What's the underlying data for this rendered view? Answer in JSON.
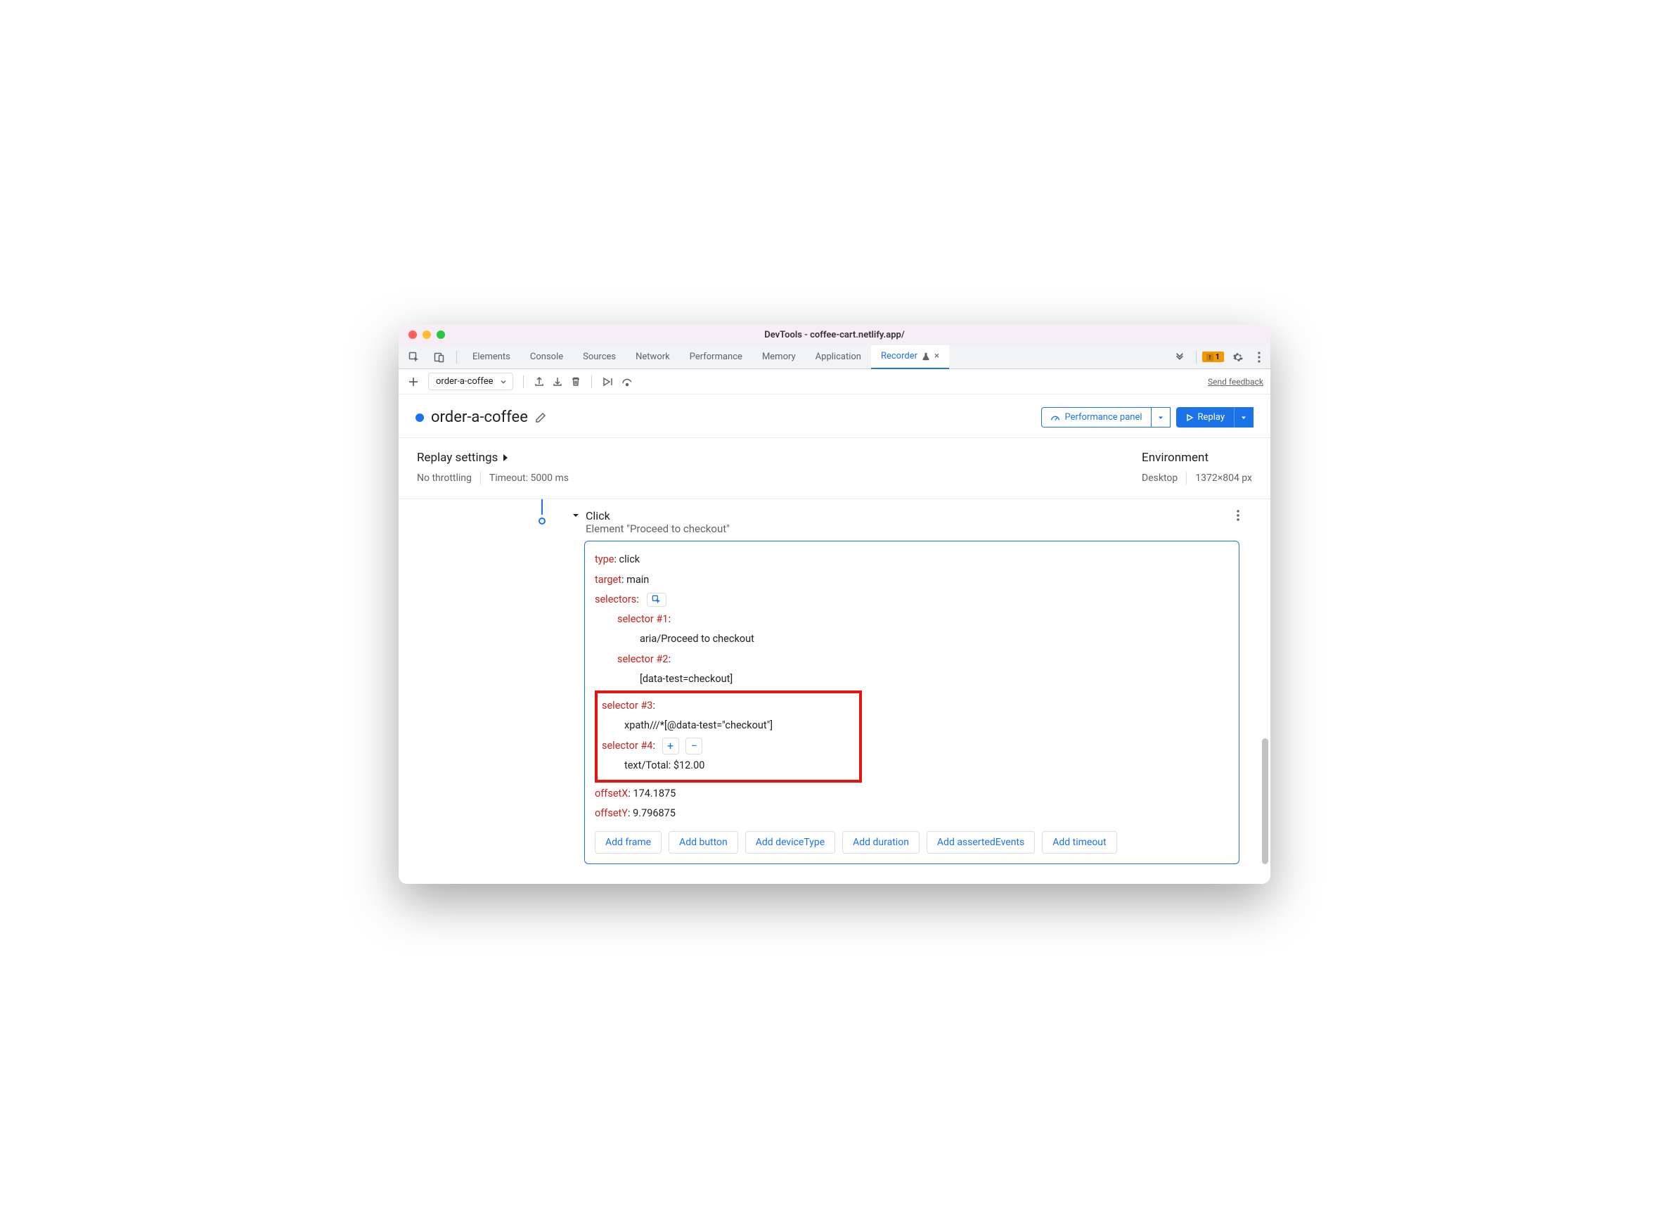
{
  "window": {
    "title": "DevTools - coffee-cart.netlify.app/"
  },
  "tabs": {
    "items": [
      "Elements",
      "Console",
      "Sources",
      "Network",
      "Performance",
      "Memory",
      "Application",
      "Recorder"
    ],
    "activeIndex": 7,
    "warning_count": "1"
  },
  "subtoolbar": {
    "recording_name": "order-a-coffee",
    "send_feedback": "Send feedback"
  },
  "header": {
    "title": "order-a-coffee",
    "perf_panel": "Performance panel",
    "replay": "Replay"
  },
  "settings": {
    "replay_heading": "Replay settings",
    "throttling": "No throttling",
    "timeout": "Timeout: 5000 ms",
    "env_heading": "Environment",
    "device": "Desktop",
    "dimensions": "1372×804 px"
  },
  "step": {
    "title": "Click",
    "subtitle": "Element \"Proceed to checkout\"",
    "type_key": "type",
    "type_val": "click",
    "target_key": "target",
    "target_val": "main",
    "selectors_key": "selectors",
    "sel1_key": "selector #1",
    "sel1_val": "aria/Proceed to checkout",
    "sel2_key": "selector #2",
    "sel2_val": "[data-test=checkout]",
    "sel3_key": "selector #3",
    "sel3_val": "xpath///*[@data-test=\"checkout\"]",
    "sel4_key": "selector #4",
    "sel4_val": "text/Total: $12.00",
    "offx_key": "offsetX",
    "offx_val": "174.1875",
    "offy_key": "offsetY",
    "offy_val": "9.796875"
  },
  "add_buttons": [
    "Add frame",
    "Add button",
    "Add deviceType",
    "Add duration",
    "Add assertedEvents",
    "Add timeout"
  ]
}
